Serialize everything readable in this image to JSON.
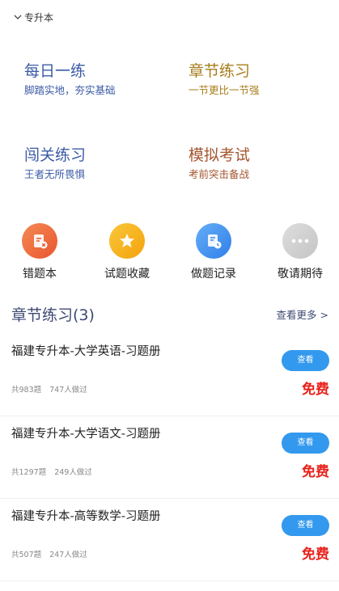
{
  "header": {
    "title": "专升本"
  },
  "tiles": [
    {
      "title": "每日一练",
      "subtitle": "脚踏实地，夯实基础"
    },
    {
      "title": "章节练习",
      "subtitle": "一节更比一节强"
    },
    {
      "title": "闯关练习",
      "subtitle": "王者无所畏惧"
    },
    {
      "title": "模拟考试",
      "subtitle": "考前突击备战"
    }
  ],
  "shortcuts": [
    {
      "label": "错题本",
      "icon": "wrong-book-icon",
      "color": "#ef6a3c"
    },
    {
      "label": "试题收藏",
      "icon": "star-icon",
      "color": "#f5b018"
    },
    {
      "label": "做题记录",
      "icon": "record-icon",
      "color": "#3d8ef0"
    },
    {
      "label": "敬请期待",
      "icon": "more-dots-icon",
      "color": "#d0d0d0"
    }
  ],
  "section": {
    "title": "章节练习(3)",
    "more": "查看更多 >"
  },
  "books": [
    {
      "name": "福建专升本-大学英语-习题册",
      "button": "查看",
      "count": "共983题",
      "done": "747人做过",
      "price": "免费"
    },
    {
      "name": "福建专升本-大学语文-习题册",
      "button": "查看",
      "count": "共1297题",
      "done": "249人做过",
      "price": "免费"
    },
    {
      "name": "福建专升本-高等数学-习题册",
      "button": "查看",
      "count": "共507题",
      "done": "247人做过",
      "price": "免费"
    }
  ]
}
